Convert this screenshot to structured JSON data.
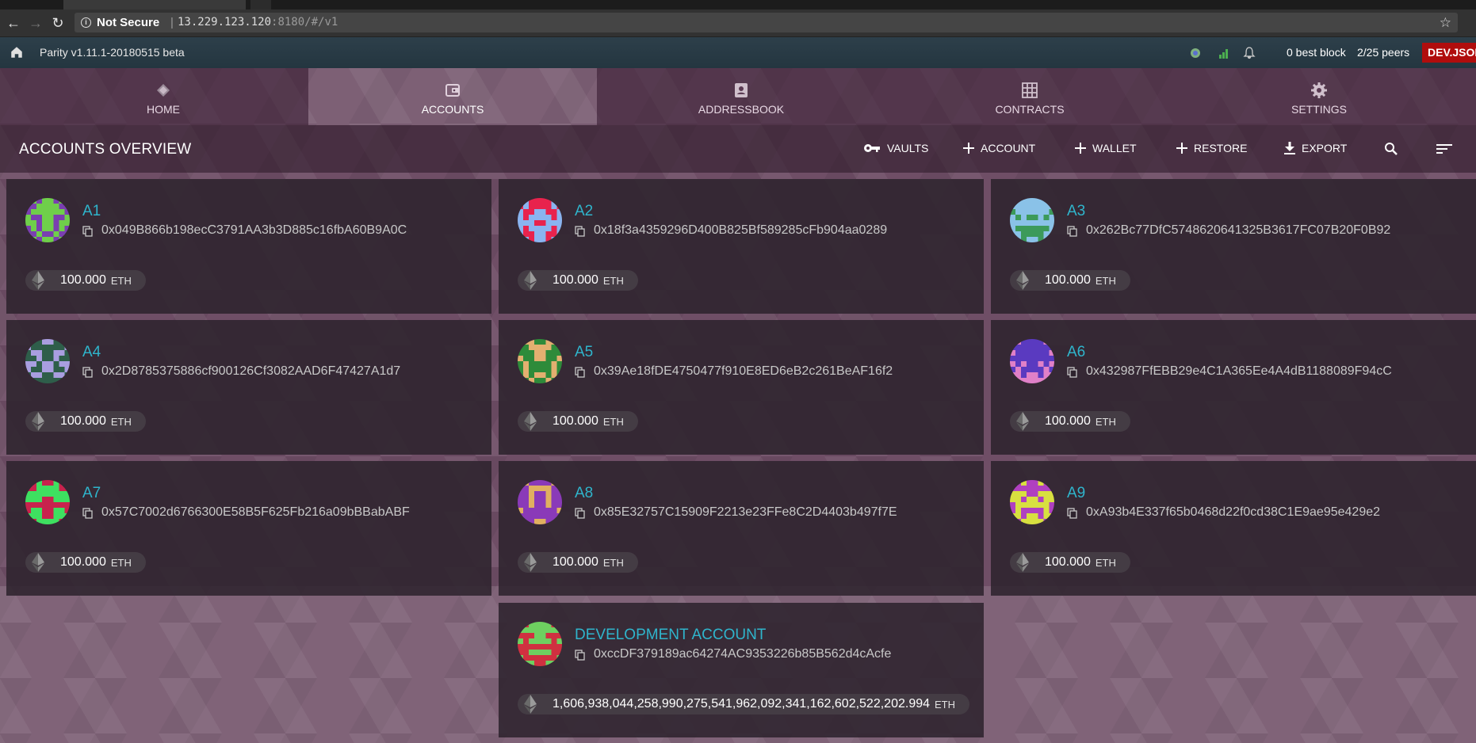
{
  "browser": {
    "security_label": "Not Secure",
    "url_host": "13.229.123.120",
    "url_rest": ":8180/#/v1"
  },
  "statusbar": {
    "version": "Parity v1.11.1-20180515 beta",
    "best_block": "0 best block",
    "peers": "2/25 peers",
    "badge": "DEV.JSON"
  },
  "tabs": [
    {
      "label": "HOME",
      "icon": "parity-logo-icon",
      "active": false
    },
    {
      "label": "ACCOUNTS",
      "icon": "wallet-icon",
      "active": true
    },
    {
      "label": "ADDRESSBOOK",
      "icon": "contact-card-icon",
      "active": false
    },
    {
      "label": "CONTRACTS",
      "icon": "grid-icon",
      "active": false
    },
    {
      "label": "SETTINGS",
      "icon": "gear-icon",
      "active": false
    }
  ],
  "overview": {
    "title": "ACCOUNTS OVERVIEW",
    "buttons": [
      {
        "label": "VAULTS",
        "icon": "key-icon"
      },
      {
        "label": "ACCOUNT",
        "icon": "plus-icon"
      },
      {
        "label": "WALLET",
        "icon": "plus-icon"
      },
      {
        "label": "RESTORE",
        "icon": "plus-icon"
      },
      {
        "label": "EXPORT",
        "icon": "download-icon"
      }
    ]
  },
  "accounts": [
    {
      "name": "A1",
      "address": "0x049B866b198ecC3791AA3b3D885c16fbA60B9A0C",
      "balance": "100.000",
      "unit": "ETH",
      "colors": [
        "#7a3fb0",
        "#6fcf4a"
      ]
    },
    {
      "name": "A2",
      "address": "0x18f3a4359296D400B825Bf589285cFb904aa0289",
      "balance": "100.000",
      "unit": "ETH",
      "colors": [
        "#e8234d",
        "#8ab4f0"
      ]
    },
    {
      "name": "A3",
      "address": "0x262Bc77DfC5748620641325B3617FC07B20F0B92",
      "balance": "100.000",
      "unit": "ETH",
      "colors": [
        "#3c9a5a",
        "#8ac2e8"
      ]
    },
    {
      "name": "A4",
      "address": "0x2D8785375886cf900126Cf3082AAD6F47427A1d7",
      "balance": "100.000",
      "unit": "ETH",
      "colors": [
        "#2e5e4a",
        "#a99ee0"
      ]
    },
    {
      "name": "A5",
      "address": "0x39Ae18fDE4750477f910E8ED6eB2c261BeAF16f2",
      "balance": "100.000",
      "unit": "ETH",
      "colors": [
        "#2e8b3a",
        "#e3b070"
      ]
    },
    {
      "name": "A6",
      "address": "0x432987FfEBB29e4C1A365Ee4A4dB1188089F94cC",
      "balance": "100.000",
      "unit": "ETH",
      "colors": [
        "#5a3ac0",
        "#e080c8"
      ]
    },
    {
      "name": "A7",
      "address": "0x57C7002d6766300E58B5F625Fb216a09bBBabABF",
      "balance": "100.000",
      "unit": "ETH",
      "colors": [
        "#c8234d",
        "#3ee060"
      ]
    },
    {
      "name": "A8",
      "address": "0x85E32757C15909F2213e23FFe8C2D4403b497f7E",
      "balance": "100.000",
      "unit": "ETH",
      "colors": [
        "#8a3ab8",
        "#e0b060"
      ]
    },
    {
      "name": "A9",
      "address": "0xA93b4E337f65b0468d22f0cd38C1E9ae95e429e2",
      "balance": "100.000",
      "unit": "ETH",
      "colors": [
        "#b040c0",
        "#d8e040"
      ]
    },
    {
      "name": "DEVELOPMENT ACCOUNT",
      "address": "0xccDF379189ac64274AC9353226b85B562d4cAcfe",
      "balance": "1,606,938,044,258,990,275,541,962,092,341,162,602,522,202.994",
      "unit": "ETH",
      "colors": [
        "#d03040",
        "#6ed060"
      ]
    }
  ]
}
